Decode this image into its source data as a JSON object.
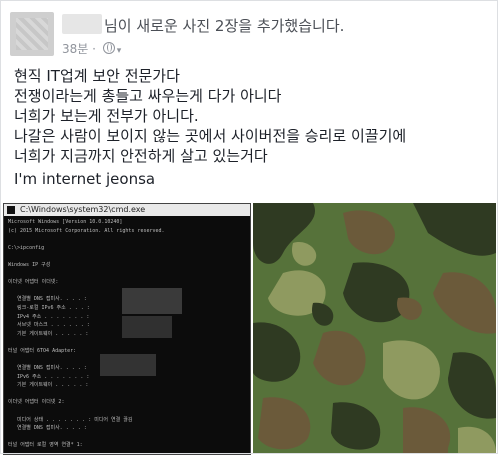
{
  "post": {
    "header_text": "님이 새로운 사진 2장을 추가했습니다.",
    "time": "38분",
    "separator": "·",
    "lines": [
      "현직 IT업계 보안 전문가다",
      "전쟁이라는게 총들고 싸우는게 다가 아니다",
      "너희가 보는게 전부가 아니다.",
      "나갈은 사람이 보이지 않는 곳에서 사이버전을 승리로 이끌기에",
      "너희가 지금까지 안전하게 살고 있는거다"
    ],
    "signature": "I'm internet jeonsa"
  },
  "cmd": {
    "title": "C:\\Windows\\system32\\cmd.exe",
    "lines": [
      "Microsoft Windows [Version 10.0.10240]",
      "(c) 2015 Microsoft Corporation. All rights reserved.",
      "",
      "C:\\>ipconfig",
      "",
      "Windows IP 구성",
      "",
      "이더넷 어댑터 이더넷:",
      "",
      "   연결별 DNS 접미사. . . . :",
      "   링크-로컬 IPv6 주소 . . . :",
      "   IPv4 주소 . . . . . . . :",
      "   서브넷 마스크 . . . . . . :",
      "   기본 게이트웨이 . . . . . :",
      "",
      "터널 어댑터 6TO4 Adapter:",
      "",
      "   연결별 DNS 접미사. . . . :",
      "   IPv6 주소 . . . . . . . :",
      "   기본 게이트웨이 . . . . . :",
      "",
      "이더넷 어댑터 이더넷 2:",
      "",
      "   미디어 상태 . . . . . . . : 미디어 연결 끊김",
      "   연결별 DNS 접미사. . . . :",
      "",
      "터널 어댑터 로컬 영역 연결* 1:",
      "",
      "   연결별 DNS 접미사. . . . :"
    ]
  },
  "colors": {
    "camo_dark": "#2f3a22",
    "camo_green": "#56723a",
    "camo_brown": "#6b5a3a",
    "camo_light": "#8f9a60"
  }
}
